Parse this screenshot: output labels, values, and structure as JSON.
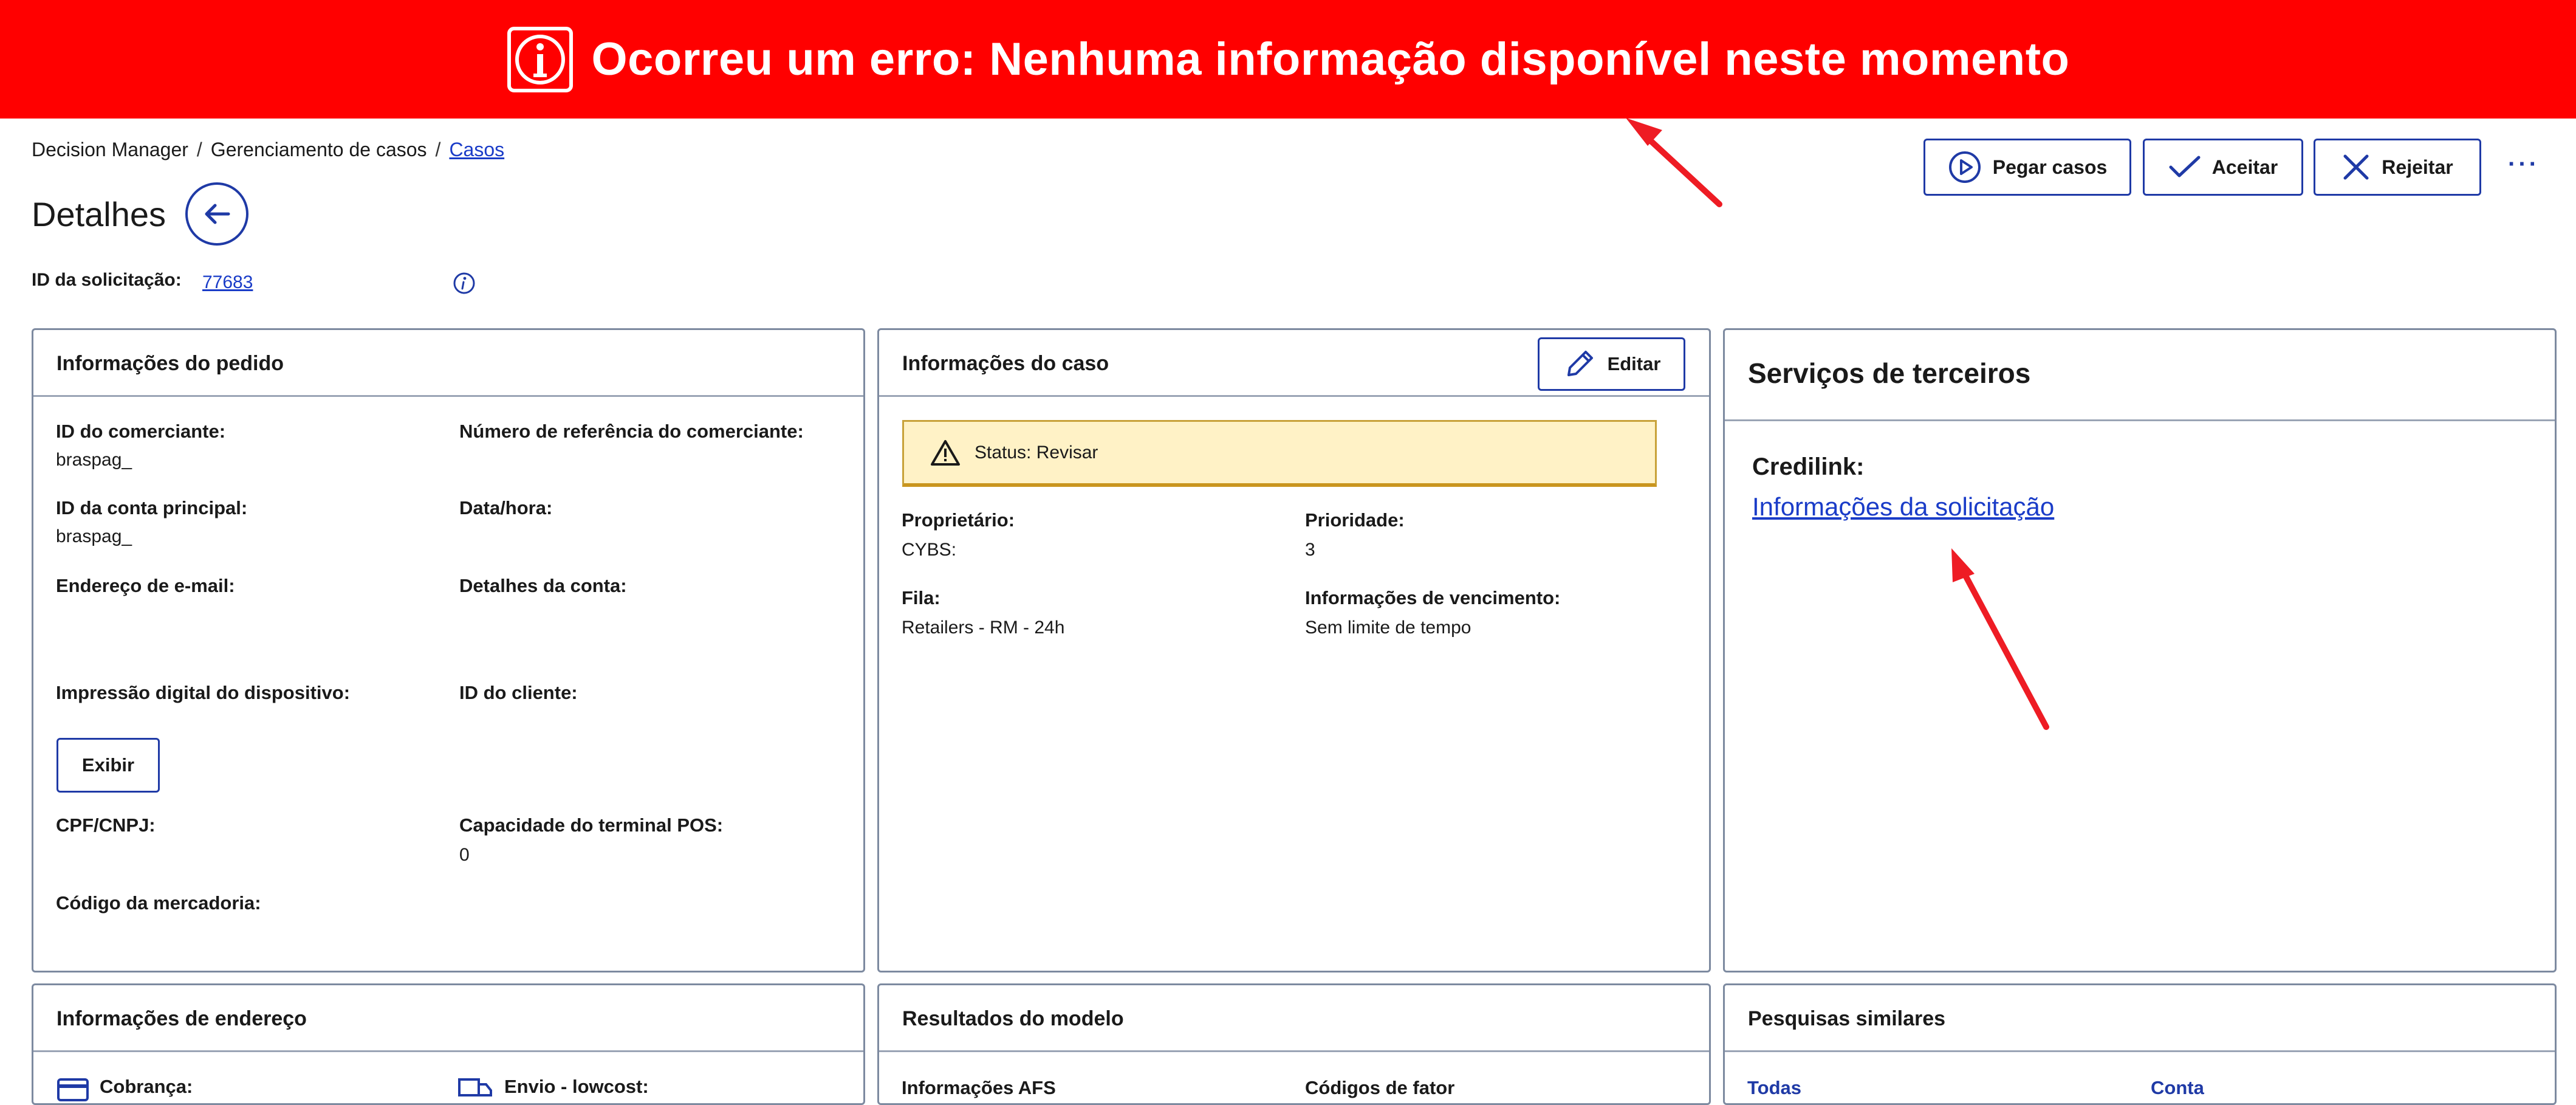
{
  "banner": {
    "text": "Ocorreu um erro: Nenhuma informação disponível neste momento",
    "color": "#ff0000"
  },
  "breadcrumb": {
    "item1": "Decision Manager",
    "item2": "Gerenciamento de casos",
    "item3": "Casos",
    "separator": "/"
  },
  "page": {
    "title": "Detalhes",
    "request_label": "ID da solicitação:",
    "request_id": "77683"
  },
  "actions": {
    "take_cases": "Pegar casos",
    "accept": "Aceitar",
    "reject": "Rejeitar",
    "more": "···"
  },
  "order_info": {
    "title": "Informações do pedido",
    "merchant_id_label": "ID do comerciante:",
    "merchant_id_value": "braspag_",
    "merchant_ref_label": "Número de referência do comerciante:",
    "main_account_label": "ID da conta principal:",
    "main_account_value": "braspag_",
    "datetime_label": "Data/hora:",
    "email_label": "Endereço de e-mail:",
    "account_details_label": "Detalhes da conta:",
    "device_fp_label": "Impressão digital do dispositivo:",
    "customer_id_label": "ID do cliente:",
    "show_button": "Exibir",
    "cpf_label": "CPF/CNPJ:",
    "pos_label": "Capacidade do terminal POS:",
    "pos_value": "0",
    "merchandise_label": "Código da mercadoria:"
  },
  "case_info": {
    "title": "Informações do caso",
    "edit_button": "Editar",
    "status": "Status: Revisar",
    "owner_label": "Proprietário:",
    "owner_value": "CYBS:",
    "priority_label": "Prioridade:",
    "priority_value": "3",
    "queue_label": "Fila:",
    "queue_value": "Retailers - RM - 24h",
    "due_label": "Informações de vencimento:",
    "due_value": "Sem limite de tempo"
  },
  "third_party": {
    "title": "Serviços de terceiros",
    "provider": "Credilink:",
    "link": "Informações da solicitação"
  },
  "address_info": {
    "title": "Informações de endereço",
    "billing": "Cobrança:",
    "shipping": "Envio - lowcost:"
  },
  "model_results": {
    "title": "Resultados do modelo",
    "afs": "Informações AFS",
    "factor_codes": "Códigos de fator"
  },
  "similar_searches": {
    "title": "Pesquisas similares",
    "all": "Todas",
    "account": "Conta"
  },
  "colors": {
    "accent": "#1f3aa6",
    "link": "#1a3cc8",
    "status_bg": "#fff2c6",
    "border": "#7d8aa0",
    "arrow": "#ee1c24"
  }
}
